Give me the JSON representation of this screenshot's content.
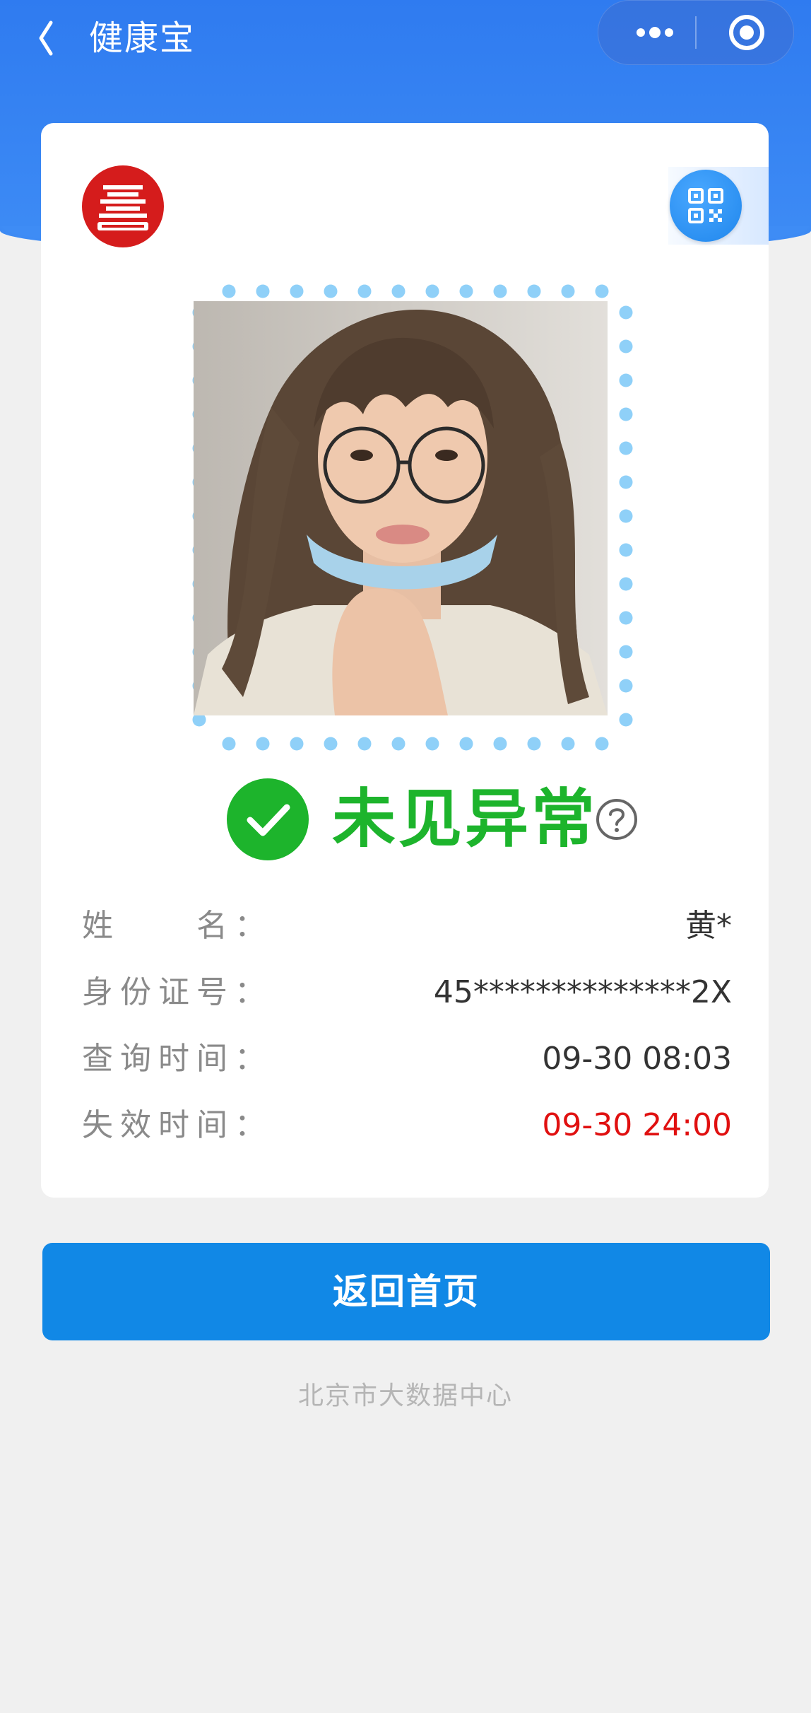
{
  "nav": {
    "title": "健康宝"
  },
  "status": {
    "text": "未见异常",
    "color": "#1db42c"
  },
  "info": [
    {
      "label": "姓　　名：",
      "value": "黄*"
    },
    {
      "label": "身份证号：",
      "value": "45**************2X"
    },
    {
      "label": "查询时间：",
      "value": "09-30 08:03"
    },
    {
      "label": "失效时间：",
      "value": "09-30 24:00"
    }
  ],
  "actions": {
    "home_label": "返回首页"
  },
  "footer": {
    "org": "北京市大数据中心"
  },
  "colors": {
    "header_blue": "#2f7bf0",
    "button_blue": "#1188e6",
    "alert_red": "#e01010",
    "logo_red": "#d51c1c"
  },
  "icons": [
    "back-icon",
    "more-icon",
    "close-circle-icon",
    "logo",
    "qr-code-icon",
    "check-icon",
    "help-icon"
  ]
}
